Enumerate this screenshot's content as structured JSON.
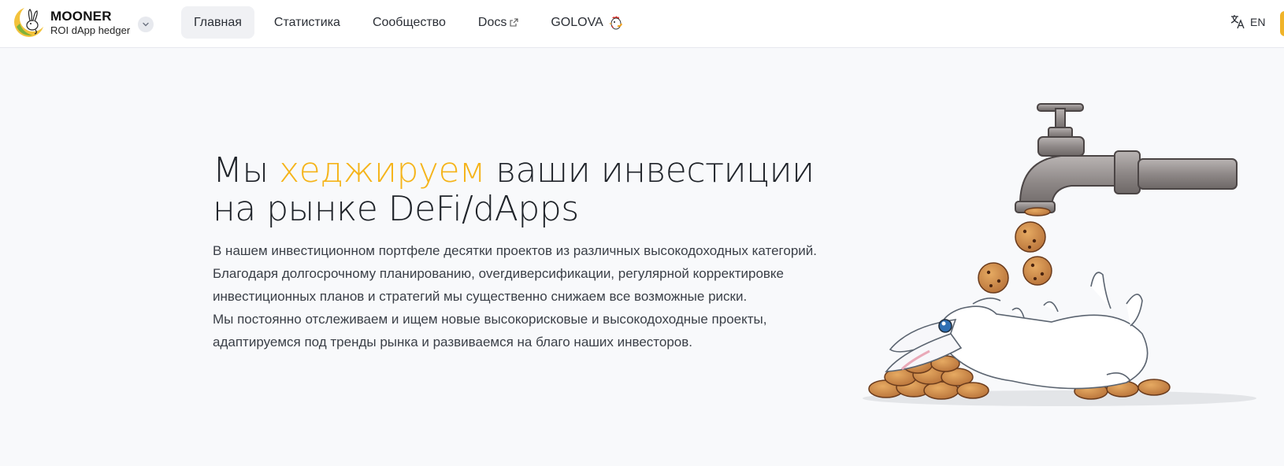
{
  "header": {
    "brand_name": "MOONER",
    "brand_sub": "ROI dApp hedger",
    "logo_icon": "moon-rabbit-icon",
    "toggle_icon": "chevron-down-icon",
    "nav": {
      "home": "Главная",
      "stats": "Статистика",
      "community": "Сообщество",
      "docs": "Docs",
      "golova": "GOLOVA"
    },
    "lang": "EN",
    "lang_icon": "translate-icon"
  },
  "hero": {
    "title_pre": "Мы ",
    "title_accent": "хеджируем",
    "title_post": " ваши инвестиции",
    "title_line2": "на рынке DeFi/dApps",
    "para1_line1": "В нашем инвестиционном портфеле десятки проектов из различных высокодоходных категорий.",
    "para1_line2": "Благодаря долгосрочному планированию, overдиверсификации, регулярной корректировке",
    "para1_line3": "инвестиционных планов и стратегий мы существенно снижаем все возможные риски.",
    "para2_line1": "Мы постоянно отслеживаем и ищем новые высокорисковые и высокодоходные проекты,",
    "para2_line2": "адаптируемся под тренды рынка и развиваемся на благо наших инвесторов."
  },
  "colors": {
    "accent": "#f5b41a",
    "background": "#f8f9fb",
    "header_bg": "#ffffff",
    "active_nav_bg": "#f0f1f4"
  },
  "illustration": "rabbit-faucet-cookies"
}
